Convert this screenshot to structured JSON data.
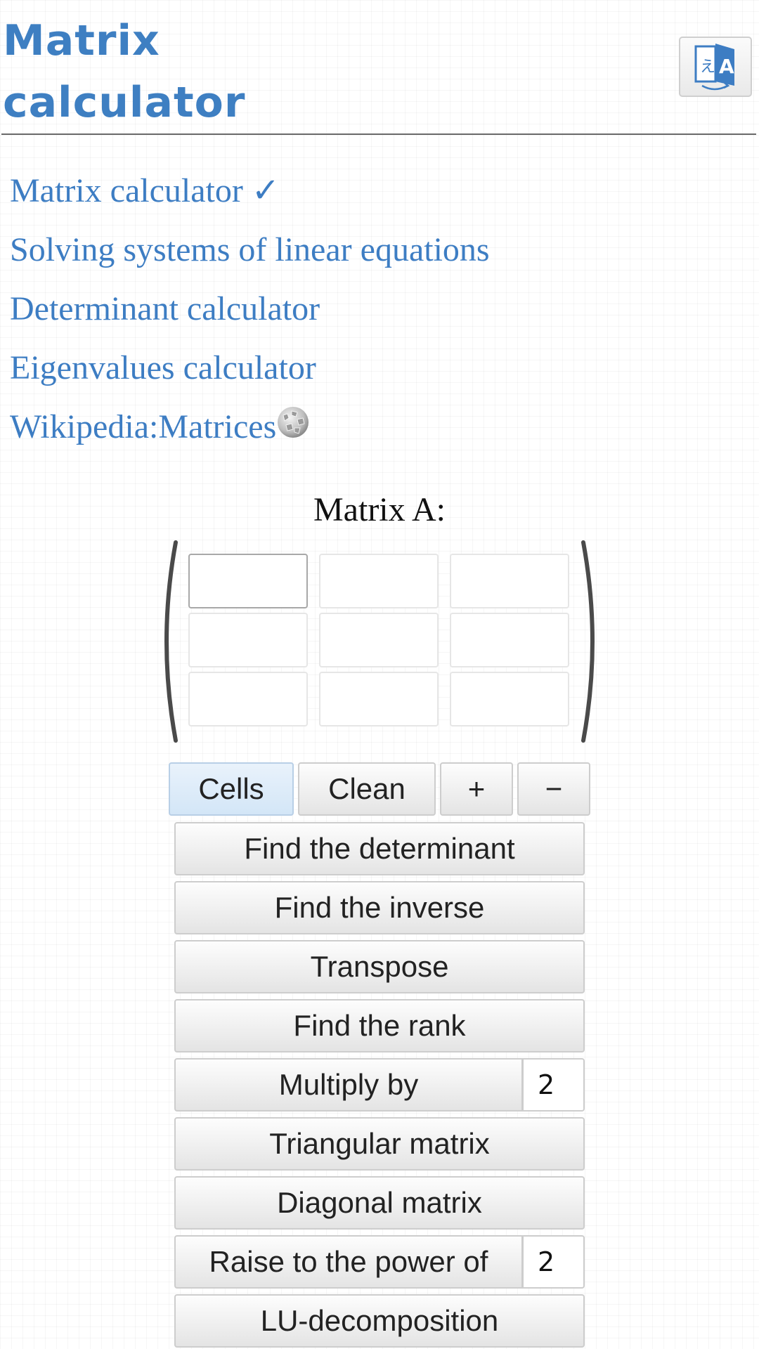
{
  "header": {
    "title_line1": "Matrix",
    "title_line2": "calculator",
    "language_button_icon": "translate-icon"
  },
  "nav": {
    "links": [
      {
        "label": "Matrix calculator ✓"
      },
      {
        "label": "Solving systems of linear equations"
      },
      {
        "label": "Determinant calculator"
      },
      {
        "label": "Eigenvalues calculator"
      },
      {
        "label": "Wikipedia:Matrices",
        "icon": "wikipedia-globe-icon"
      }
    ]
  },
  "matrix": {
    "label": "Matrix A:",
    "rows": 3,
    "cols": 3,
    "cells": [
      [
        "",
        "",
        ""
      ],
      [
        "",
        "",
        ""
      ],
      [
        "",
        "",
        ""
      ]
    ]
  },
  "toolbar": {
    "cells_label": "Cells",
    "clean_label": "Clean",
    "plus_label": "+",
    "minus_label": "−"
  },
  "operations": {
    "determinant": "Find the determinant",
    "inverse": "Find the inverse",
    "transpose": "Transpose",
    "rank": "Find the rank",
    "multiply_by": "Multiply by",
    "multiply_value": "2",
    "triangular": "Triangular matrix",
    "diagonal": "Diagonal matrix",
    "power": "Raise to the power of",
    "power_value": "2",
    "lu": "LU-decomposition"
  },
  "colors": {
    "link": "#3d7dc3",
    "title": "#3e7fc2",
    "selected_button": "#d3e6f7"
  }
}
